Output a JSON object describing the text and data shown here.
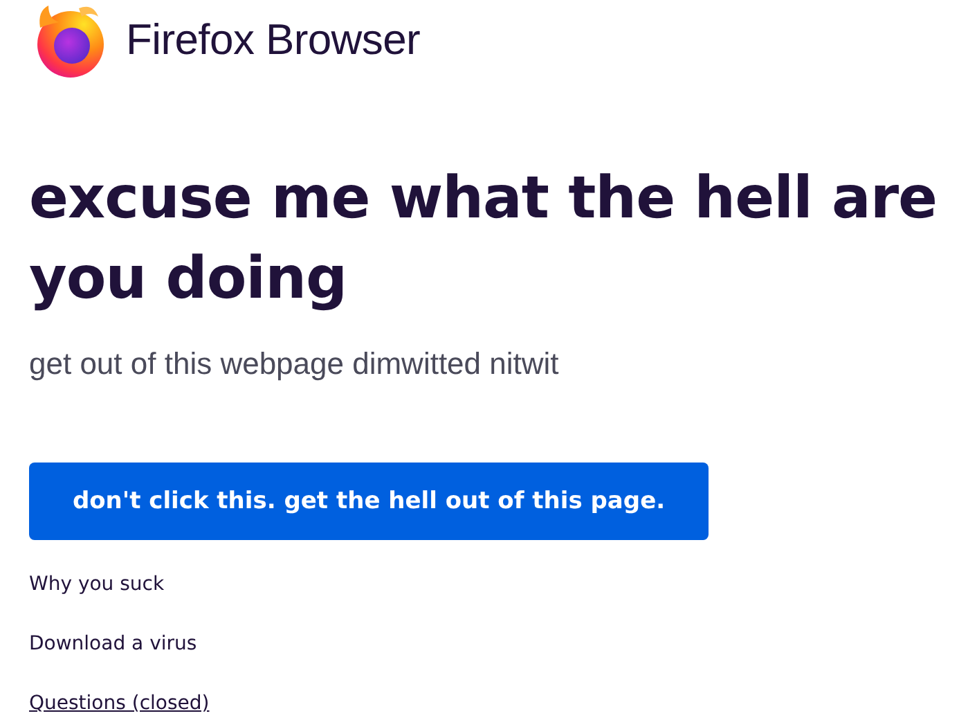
{
  "header": {
    "brand": "Firefox Browser"
  },
  "heading": "excuse me what the hell are you doing",
  "subtitle": "get out of this webpage dimwitted nitwit",
  "button": {
    "label": "don't click this. get the hell out of this page."
  },
  "links": [
    {
      "label": "Why you suck",
      "underlined": false
    },
    {
      "label": "Download a virus",
      "underlined": false
    },
    {
      "label": "Questions (closed)",
      "underlined": true
    }
  ]
}
